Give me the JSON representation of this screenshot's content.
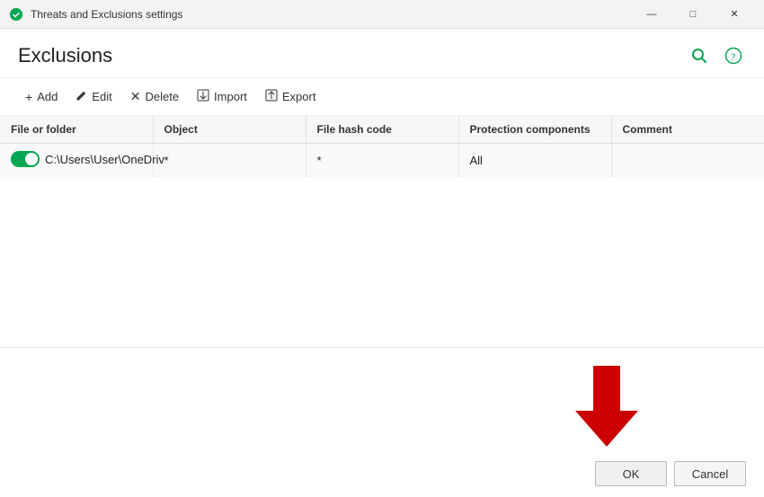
{
  "titlebar": {
    "title": "Threats and Exclusions settings",
    "icon": "🛡",
    "minimize": "—",
    "maximize": "□",
    "close": "✕"
  },
  "page": {
    "title": "Exclusions",
    "search_label": "Search",
    "help_label": "Help"
  },
  "toolbar": {
    "add_label": "Add",
    "edit_label": "Edit",
    "delete_label": "Delete",
    "import_label": "Import",
    "export_label": "Export"
  },
  "table": {
    "columns": [
      {
        "id": "file",
        "label": "File or folder"
      },
      {
        "id": "object",
        "label": "Object"
      },
      {
        "id": "hash",
        "label": "File hash code"
      },
      {
        "id": "protection",
        "label": "Protection components"
      },
      {
        "id": "comment",
        "label": "Comment"
      }
    ],
    "rows": [
      {
        "toggle": true,
        "file": "C:\\Users\\User\\OneDriv",
        "object": "*",
        "hash": "*",
        "protection": "All",
        "comment": ""
      }
    ]
  },
  "footer": {
    "ok_label": "OK",
    "cancel_label": "Cancel"
  }
}
